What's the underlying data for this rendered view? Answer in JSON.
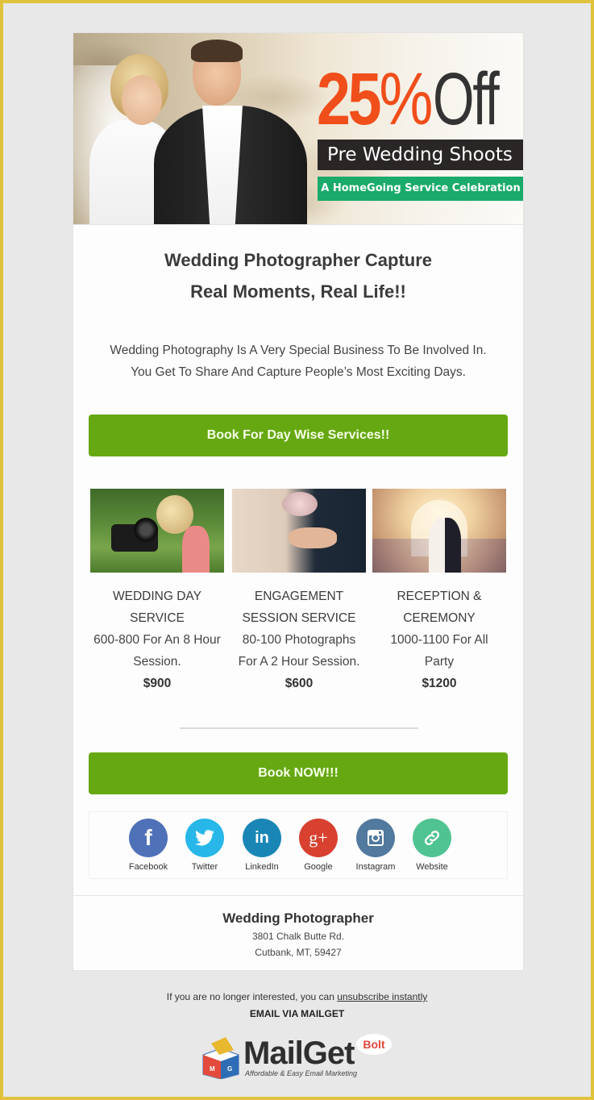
{
  "hero": {
    "discount_number": "25",
    "discount_symbol": "%",
    "discount_word": "Off",
    "band_title": "Pre Wedding Shoots",
    "band_subtitle": "A HomeGoing Service Celebration",
    "accent_color": "#f04e1a",
    "band_green_color": "#1aaa6a"
  },
  "headline": {
    "line1": "Wedding Photographer Capture",
    "line2": "Real Moments, Real Life!!"
  },
  "intro": {
    "line1": "Wedding Photography Is A Very Special Business To Be Involved In.",
    "line2": "You Get To Share And Capture People’s Most Exciting Days."
  },
  "buttons": {
    "day_wise": "Book For Day Wise Services!!",
    "book_now": "Book NOW!!!",
    "color": "#66a812"
  },
  "services": [
    {
      "title_line1": "WEDDING DAY",
      "title_line2": "SERVICE",
      "desc_line1": "600-800 For An 8 Hour",
      "desc_line2": "Session.",
      "price": "$900",
      "image": "photographer-with-camera"
    },
    {
      "title_line1": "ENGAGEMENT",
      "title_line2": "SESSION SERVICE",
      "desc_line1": "80-100 Photographs",
      "desc_line2": "For A 2 Hour Session.",
      "price": "$600",
      "image": "ring-exchange"
    },
    {
      "title_line1": "RECEPTION &",
      "title_line2": "CEREMONY",
      "desc_line1": "1000-1100 For All",
      "desc_line2": "Party",
      "price": "$1200",
      "image": "reception-dance"
    }
  ],
  "social": [
    {
      "label": "Facebook",
      "icon": "facebook-icon",
      "glyph": "f",
      "color": "#4e71b8"
    },
    {
      "label": "Twitter",
      "icon": "twitter-icon",
      "glyph": "🐦",
      "color": "#27b7e8"
    },
    {
      "label": "LinkedIn",
      "icon": "linkedin-icon",
      "glyph": "in",
      "color": "#1986b6"
    },
    {
      "label": "Google",
      "icon": "google-plus-icon",
      "glyph": "g+",
      "color": "#d8402f"
    },
    {
      "label": "Instagram",
      "icon": "instagram-icon",
      "glyph": "◙",
      "color": "#52799e"
    },
    {
      "label": "Website",
      "icon": "link-icon",
      "glyph": "🔗",
      "color": "#4fc391"
    }
  ],
  "address": {
    "name": "Wedding Photographer",
    "street": "3801 Chalk Butte Rd.",
    "city": "Cutbank, MT, 59427"
  },
  "footer": {
    "unsub_prefix": "If you are no longer interested, you can ",
    "unsub_link": "unsubscribe instantly",
    "via": "EMAIL VIA MAILGET"
  },
  "logo": {
    "brand": "MailGet",
    "badge": "Bolt",
    "tagline": "Affordable & Easy Email Marketing"
  }
}
